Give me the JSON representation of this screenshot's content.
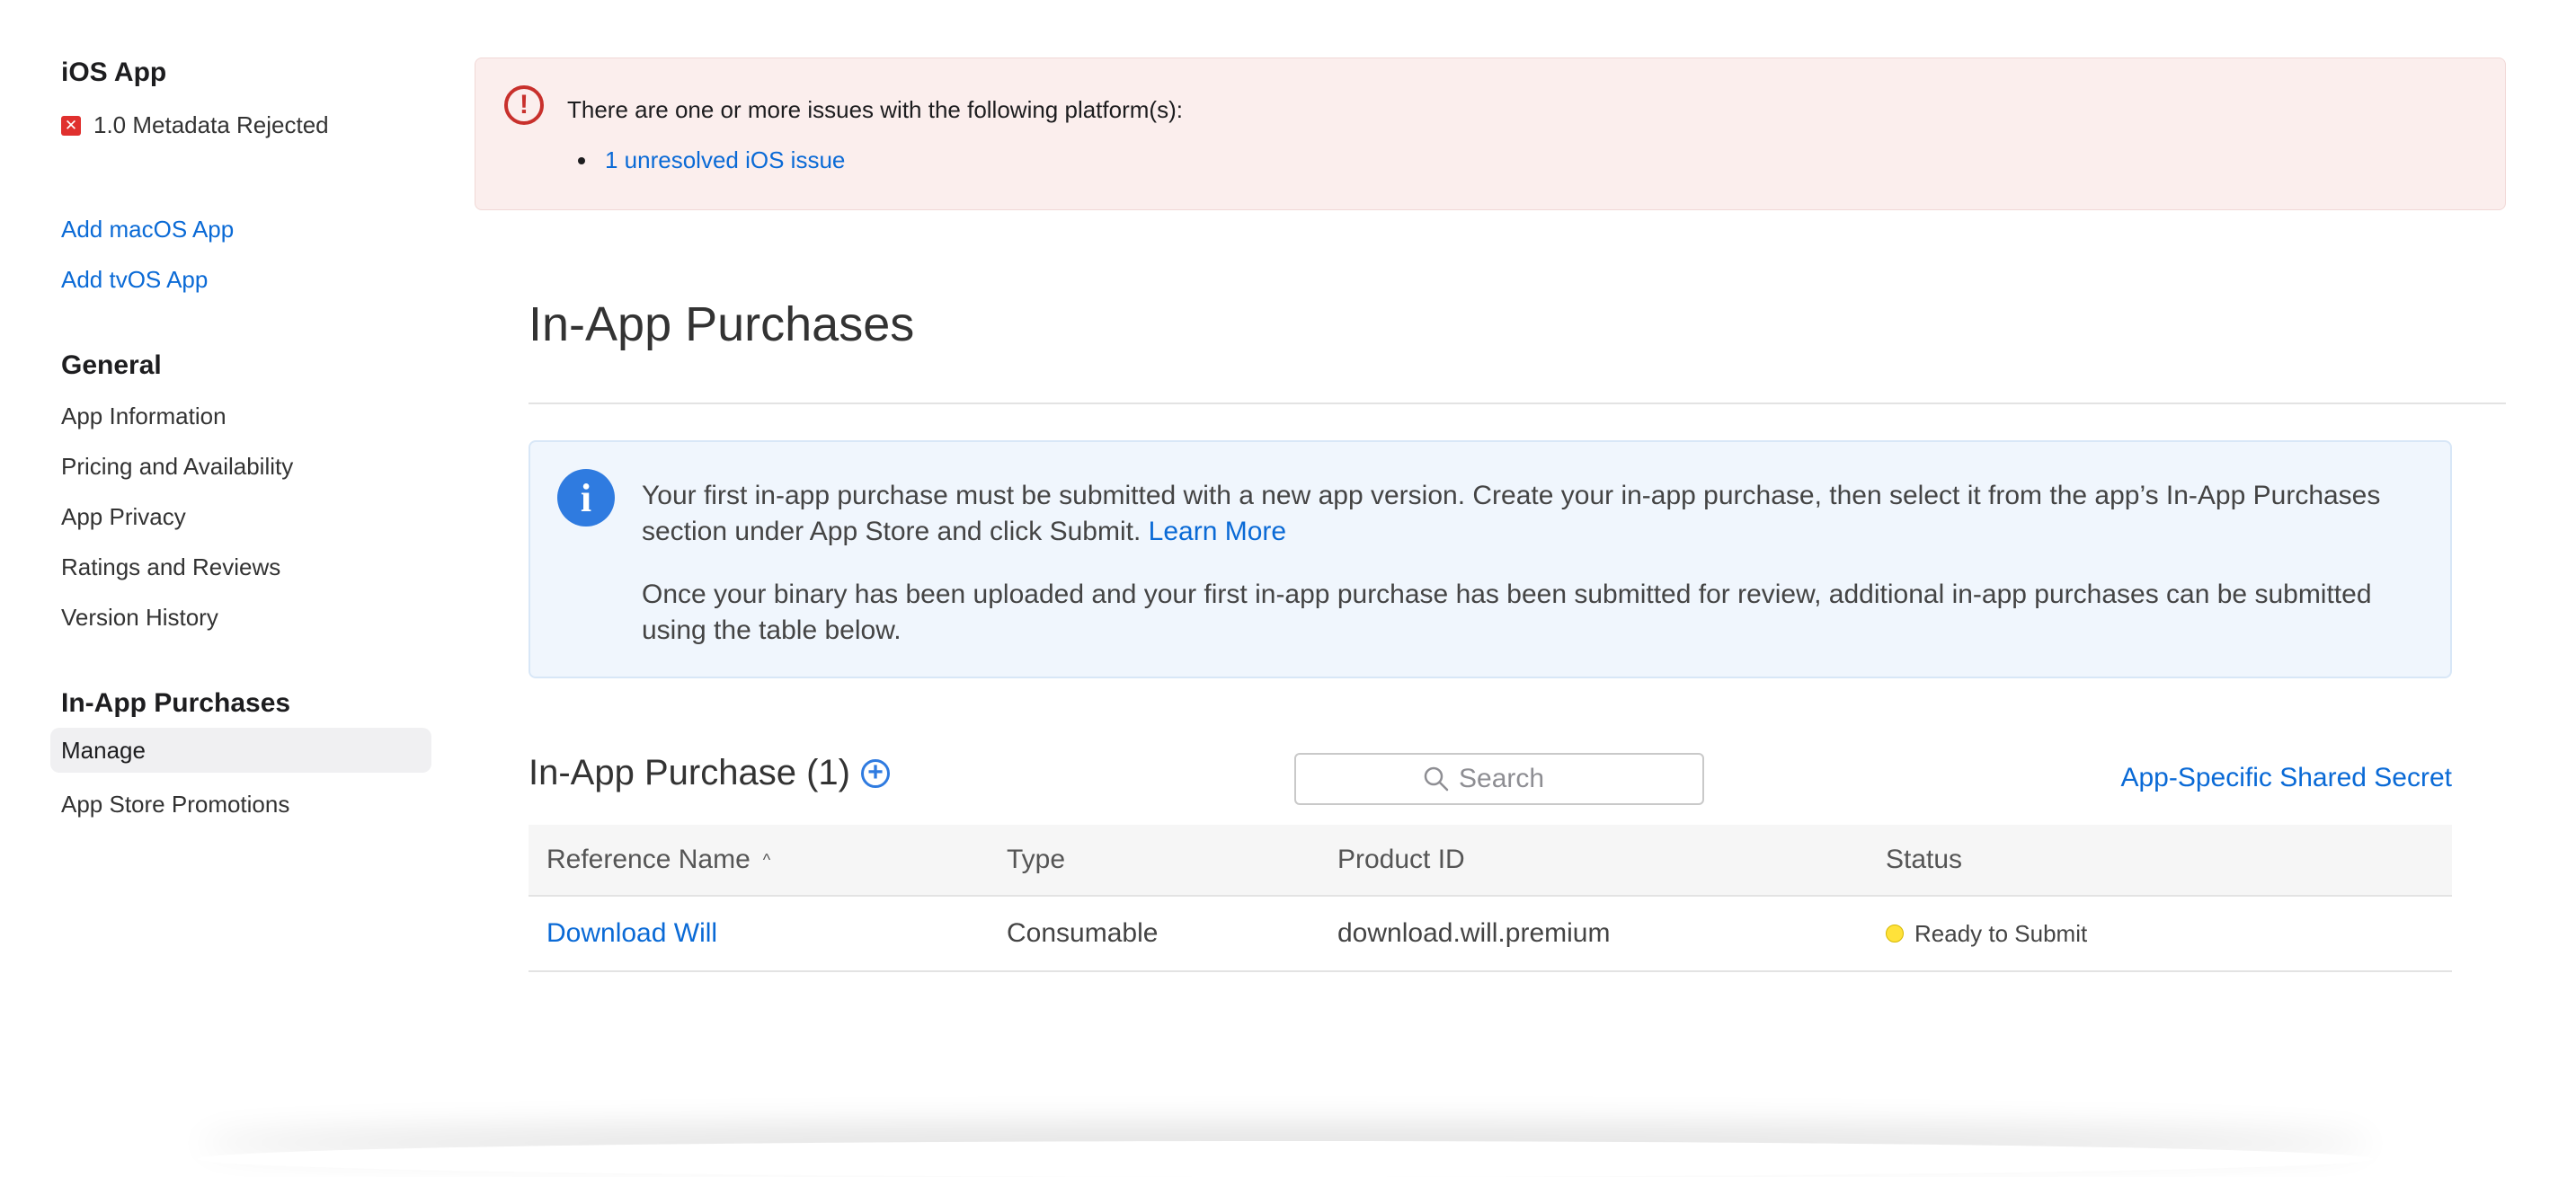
{
  "sidebar": {
    "app_title": "iOS App",
    "status": "1.0 Metadata Rejected",
    "add_links": [
      "Add macOS App",
      "Add tvOS App"
    ],
    "general_heading": "General",
    "general_items": [
      "App Information",
      "Pricing and Availability",
      "App Privacy",
      "Ratings and Reviews",
      "Version History"
    ],
    "iap_heading": "In-App Purchases",
    "iap_items": [
      "Manage",
      "App Store Promotions"
    ],
    "active_item": "Manage"
  },
  "error_banner": {
    "icon": "exclamation-circle-icon",
    "message": "There are one or more issues with the following platform(s):",
    "issue_link": "1 unresolved iOS issue",
    "color": "#c8302c"
  },
  "main": {
    "page_title": "In-App Purchases",
    "info": {
      "icon": "info-circle-icon",
      "paragraph1": "Your first in-app purchase must be submitted with a new app version. Create your in-app purchase, then select it from the app’s In-App Purchases section under App Store and click Submit.",
      "learn_more": "Learn More",
      "paragraph2": "Once your binary has been uploaded and your first in-app purchase has been submitted for review, additional in-app purchases can be submitted using the table below."
    },
    "table_title": "In-App Purchase (1)",
    "search_placeholder": "Search",
    "shared_secret_link": "App-Specific Shared Secret",
    "columns": [
      "Reference Name",
      "Type",
      "Product ID",
      "Status"
    ],
    "rows": [
      {
        "name": "Download Will",
        "type": "Consumable",
        "product_id": "download.will.premium",
        "status": "Ready to Submit",
        "status_color": "#ffe23a"
      }
    ]
  },
  "colors": {
    "link": "#0a6ad6",
    "accent": "#2f7be0",
    "error": "#c8302c"
  }
}
